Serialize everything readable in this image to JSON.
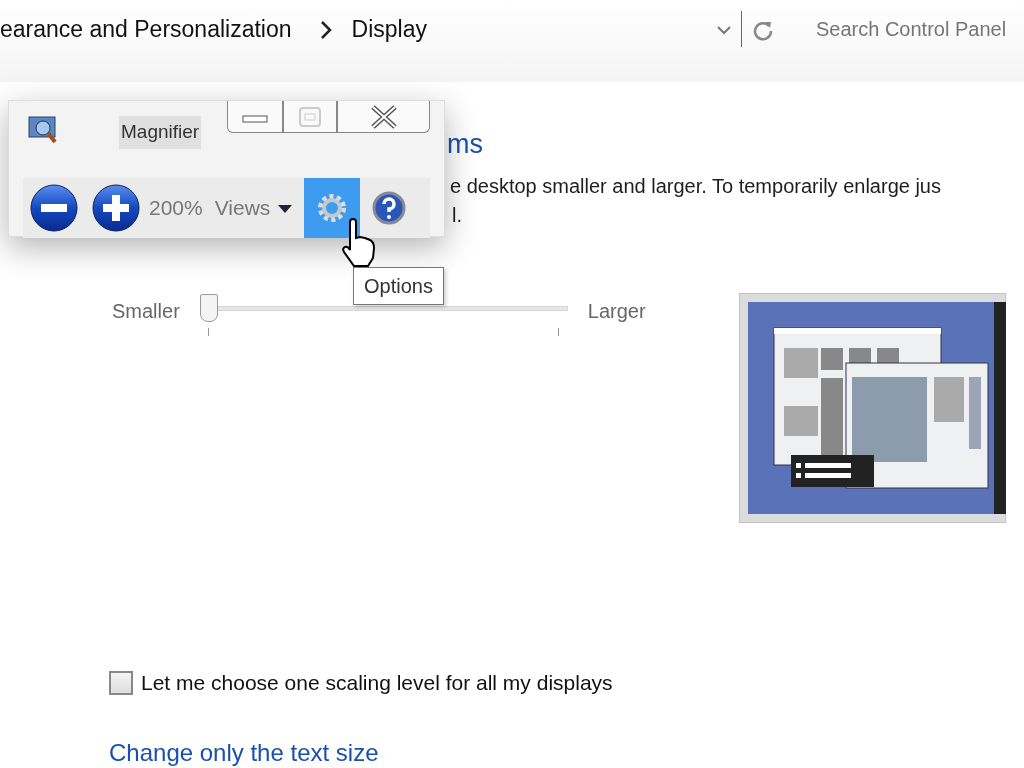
{
  "address_bar": {
    "breadcrumbs": [
      "earance and Personalization",
      "Display"
    ],
    "search": {
      "placeholder": "Search Control Panel"
    }
  },
  "magnifier": {
    "title": "Magnifier",
    "zoom": "200%",
    "views": "Views",
    "options_button": {
      "selected": true
    },
    "tooltip": "Options"
  },
  "page": {
    "heading": "ms",
    "description": [
      "e desktop smaller and larger. To temporarily enlarge jus",
      "l."
    ],
    "slider": {
      "min_label": "Smaller",
      "max_label": "Larger",
      "level": 0
    },
    "checkbox": {
      "label": "Let me choose one scaling level for all my displays",
      "checked": false
    },
    "link": "Change only the text size"
  }
}
